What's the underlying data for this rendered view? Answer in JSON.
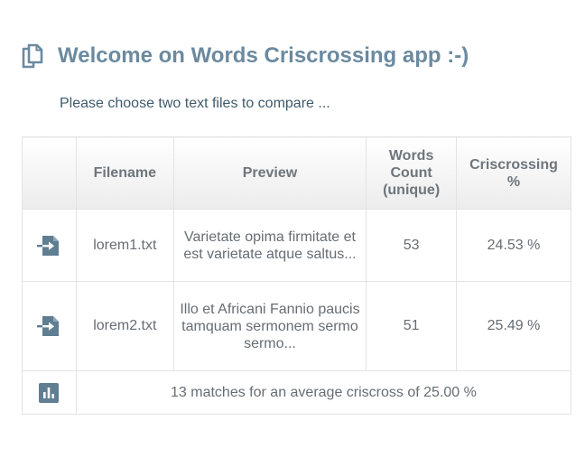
{
  "app": {
    "title": "Welcome on Words Criscrossing app :-)",
    "subtitle": "Please choose two text files to compare ...",
    "accent_color": "#6b8aa0",
    "icon": "copy-icon"
  },
  "table": {
    "headers": {
      "icon": "",
      "filename": "Filename",
      "preview": "Preview",
      "words_count": "Words Count (unique)",
      "criscrossing": "Criscrossing %"
    },
    "rows": [
      {
        "icon": "file-import-icon",
        "filename": "lorem1.txt",
        "preview": "Varietate opima firmitate et est varietate atque saltus...",
        "words_count": "53",
        "criscrossing": "24.53 %"
      },
      {
        "icon": "file-import-icon",
        "filename": "lorem2.txt",
        "preview": "Illo et Africani Fannio paucis tamquam sermonem sermo sermo...",
        "words_count": "51",
        "criscrossing": "25.49 %"
      }
    ],
    "summary": {
      "icon": "bar-chart-icon",
      "text": "13 matches for an average criscross of 25.00 %"
    }
  }
}
